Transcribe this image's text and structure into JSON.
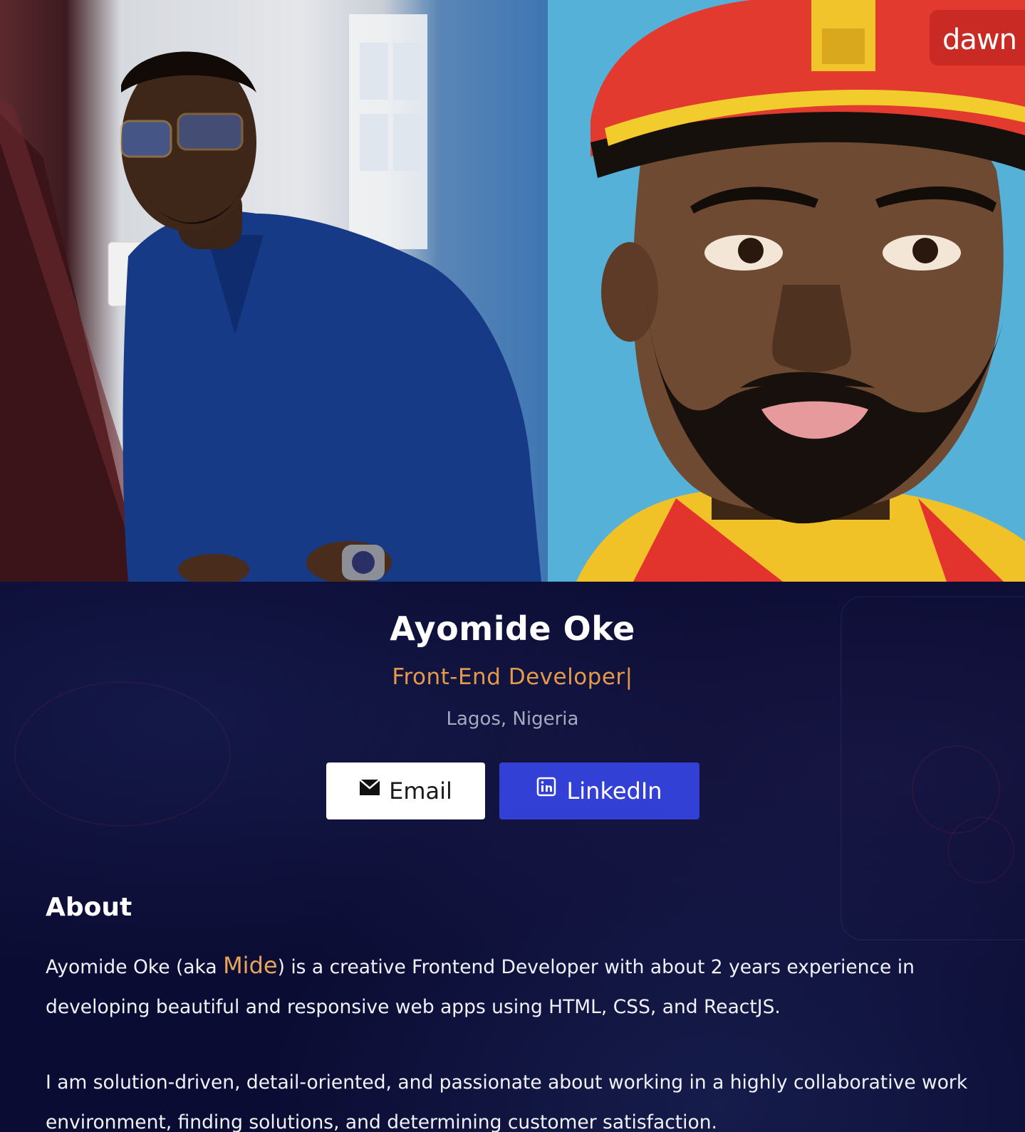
{
  "hero": {
    "watermark_text": "dawn"
  },
  "profile": {
    "name": "Ayomide Oke",
    "role": "Front-End Developer|",
    "location": "Lagos, Nigeria"
  },
  "buttons": {
    "email_label": "Email",
    "linkedin_label": "LinkedIn"
  },
  "about": {
    "title": "About",
    "p1_before": "Ayomide Oke (aka ",
    "p1_highlight": "Mide",
    "p1_after": ") is a creative Frontend Developer with about 2 years experience in developing beautiful and responsive web apps using HTML, CSS, and ReactJS.",
    "p2": "I am solution-driven, detail-oriented, and passionate about working in a highly collaborative work environment, finding solutions, and determining customer satisfaction."
  },
  "colors": {
    "background": "#0b0c33",
    "accent_orange": "#e39a4a",
    "linkedin_blue": "#3340d6",
    "email_button_bg": "#ffffff"
  },
  "icons": {
    "email": "envelope-icon",
    "linkedin": "linkedin-icon"
  }
}
